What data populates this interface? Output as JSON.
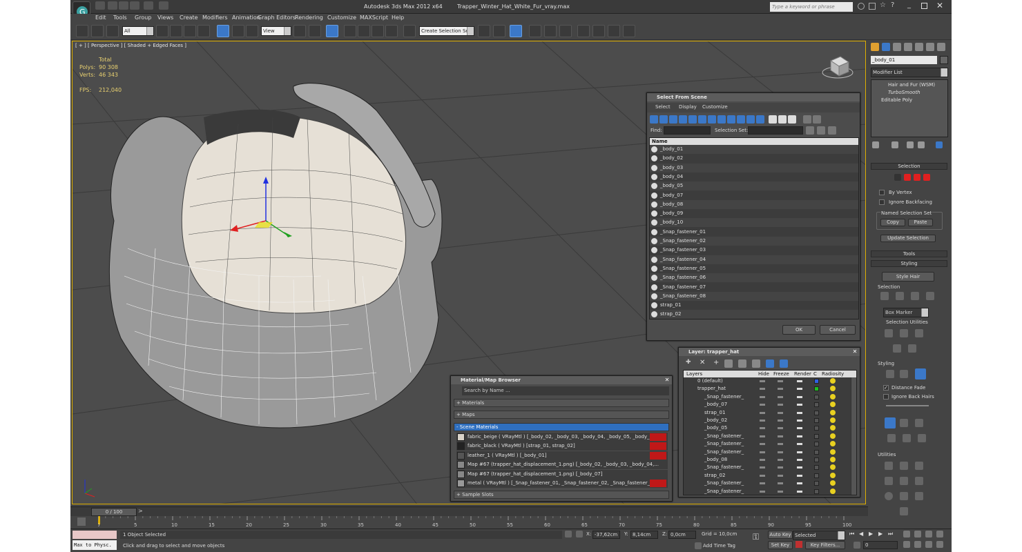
{
  "app_title": "Autodesk 3ds Max  2012 x64",
  "file_title": "Trapper_Winter_Hat_White_Fur_vray.max",
  "search_placeholder": "Type a keyword or phrase",
  "menu": [
    "Edit",
    "Tools",
    "Group",
    "Views",
    "Create",
    "Modifiers",
    "Animation",
    "Graph Editors",
    "Rendering",
    "Customize",
    "MAXScript",
    "Help"
  ],
  "toolbar": {
    "filter": "All",
    "refcoord": "View",
    "selset": "Create Selection Se"
  },
  "viewport": {
    "label": "[ + ] [ Perspective ] [ Shaded + Edged Faces ]",
    "stats": {
      "total_label": "Total",
      "polys_label": "Polys:",
      "polys": "90 308",
      "verts_label": "Verts:",
      "verts": "46 343",
      "fps_label": "FPS:",
      "fps": "212,040"
    }
  },
  "select_dialog": {
    "title": "Select From Scene",
    "menu": [
      "Select",
      "Display",
      "Customize"
    ],
    "find_label": "Find:",
    "selset_label": "Selection Set:",
    "col_name": "Name",
    "items": [
      "_body_01",
      "_body_02",
      "_body_03",
      "_body_04",
      "_body_05",
      "_body_07",
      "_body_08",
      "_body_09",
      "_body_10",
      "_Snap_fastener_01",
      "_Snap_fastener_02",
      "_Snap_fastener_03",
      "_Snap_fastener_04",
      "_Snap_fastener_05",
      "_Snap_fastener_06",
      "_Snap_fastener_07",
      "_Snap_fastener_08",
      "strap_01",
      "strap_02"
    ],
    "ok": "OK",
    "cancel": "Cancel"
  },
  "layer_dialog": {
    "title": "Layer: trapper_hat",
    "cols": [
      "Layers",
      "Hide",
      "Freeze",
      "Render",
      "C",
      "Radiosity"
    ],
    "rows": [
      "0 (default)",
      "trapper_hat",
      "_Snap_fastener_",
      "_body_07",
      "strap_01",
      "_body_02",
      "_body_05",
      "_Snap_fastener_",
      "_Snap_fastener_",
      "_Snap_fastener_",
      "_body_08",
      "_Snap_fastener_",
      "strap_02",
      "_Snap_fastener_",
      "_Snap_fastener_"
    ]
  },
  "material_browser": {
    "title": "Material/Map Browser",
    "search": "Search by Name ...",
    "sections": {
      "materials": "+ Materials",
      "maps": "+ Maps",
      "scene": "- Scene Materials",
      "slots": "+ Sample Slots"
    },
    "scene_items": [
      "fabric_beige  ( VRayMtl ) [_body_02, _body_03, _body_04, _body_05, _body_0...",
      "fabric_black  ( VRayMtl ) [strap_01, strap_02]",
      "leather_1  ( VRayMtl ) [_body_01]",
      "Map #67 (trapper_hat_displacement_1.png) [_body_02, _body_03, _body_04,...",
      "Map #67 (trapper_hat_displacement_1.png) [_body_07]",
      "metal  ( VRayMtl ) [_Snap_fastener_01, _Snap_fastener_02, _Snap_fastener_03..."
    ]
  },
  "command_panel": {
    "object_name": "_body_01",
    "modifier_list": "Modifier List",
    "stack": [
      "Hair and Fur (WSM)",
      "TurboSmooth",
      "Editable Poly"
    ],
    "selection_title": "Selection",
    "by_vertex": "By Vertex",
    "ignore_backfacing": "Ignore Backfacing",
    "named_sel": "Named Selection Set",
    "copy": "Copy",
    "paste": "Paste",
    "update_selection": "Update Selection",
    "tools": "Tools",
    "styling": "Styling",
    "style_hair": "Style Hair",
    "selection_sub": "Selection",
    "box_marker": "Box Marker",
    "selection_utilities": "Selection Utilities",
    "styling_sub": "Styling",
    "distance_fade": "Distance Fade",
    "ignore_back_hairs": "Ignore Back Hairs",
    "utilities": "Utilities"
  },
  "timeline": {
    "frame": "0 / 100",
    "ticks": [
      "0",
      "5",
      "10",
      "15",
      "20",
      "25",
      "30",
      "35",
      "40",
      "45",
      "50",
      "55",
      "60",
      "65",
      "70",
      "75",
      "80",
      "85",
      "90",
      "95",
      "100"
    ]
  },
  "status": {
    "maxscript": "Max to Physc.",
    "objects": "1 Object Selected",
    "prompt": "Click and drag to select and move objects",
    "x_label": "X:",
    "x": "-37,62cm",
    "y_label": "Y:",
    "y": "8,14cm",
    "z_label": "Z:",
    "z": "0,0cm",
    "grid": "Grid = 10,0cm",
    "add_time_tag": "Add Time Tag",
    "auto_key": "Auto Key",
    "set_key": "Set Key",
    "selected": "Selected",
    "key_filters": "Key Filters...",
    "frame_field": "0"
  }
}
